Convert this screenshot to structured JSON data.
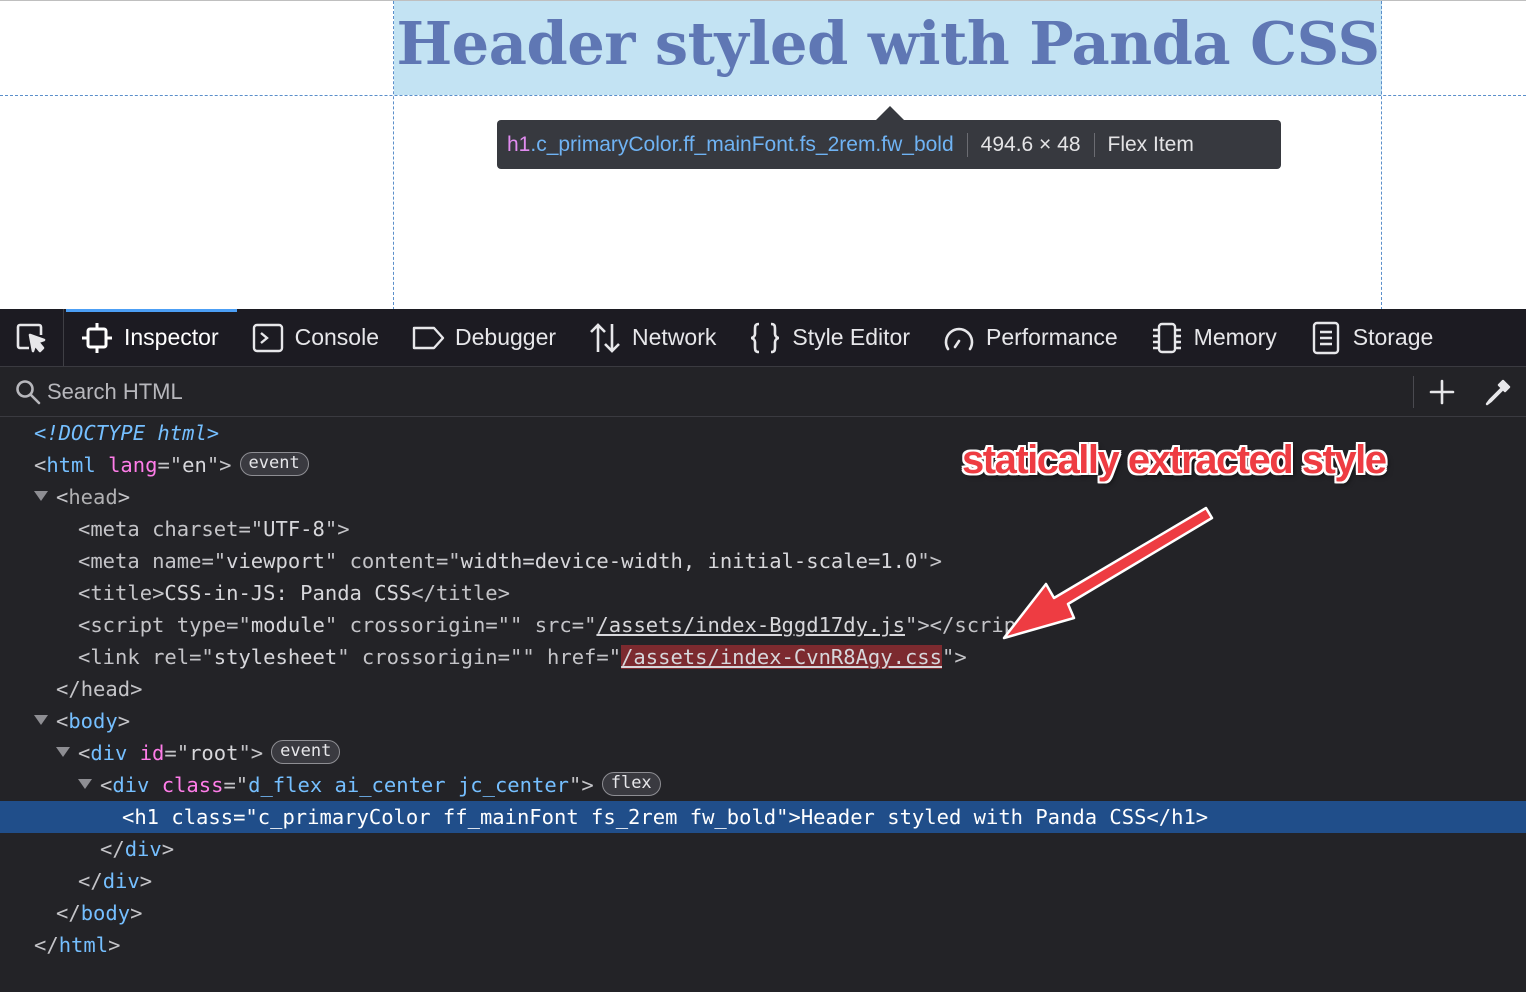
{
  "preview": {
    "heading": "Header styled with Panda CSS",
    "tooltip": {
      "tag": "h1",
      "classes": ".c_primaryColor.ff_mainFont.fs_2rem.fw_bold",
      "dimensions": "494.6 × 48",
      "role": "Flex Item"
    }
  },
  "toolbar": {
    "tabs": [
      {
        "label": "Inspector",
        "icon": "inspector-icon",
        "active": true
      },
      {
        "label": "Console",
        "icon": "console-icon"
      },
      {
        "label": "Debugger",
        "icon": "debugger-icon"
      },
      {
        "label": "Network",
        "icon": "network-icon"
      },
      {
        "label": "Style Editor",
        "icon": "style-editor-icon"
      },
      {
        "label": "Performance",
        "icon": "performance-icon"
      },
      {
        "label": "Memory",
        "icon": "memory-icon"
      },
      {
        "label": "Storage",
        "icon": "storage-icon"
      }
    ]
  },
  "search": {
    "placeholder": "Search HTML"
  },
  "tree": {
    "doctype": "<!DOCTYPE html>",
    "html_tag": "html",
    "lang_attr": "lang",
    "lang_val": "en",
    "event_badge": "event",
    "head_tag": "head",
    "meta_charset_attr": "charset",
    "meta_charset_val": "UTF-8",
    "meta_name_attr": "name",
    "meta_name_val": "viewport",
    "meta_content_attr": "content",
    "meta_content_val": "width=device-width, initial-scale=1.0",
    "title_tag": "title",
    "title_text": "CSS-in-JS: Panda CSS",
    "script_tag": "script",
    "type_attr": "type",
    "type_val": "module",
    "crossorigin_attr": "crossorigin",
    "crossorigin_val": "",
    "src_attr": "src",
    "src_val": "/assets/index-Bggd17dy.js",
    "link_tag": "link",
    "rel_attr": "rel",
    "rel_val": "stylesheet",
    "href_attr": "href",
    "href_val": "/assets/index-CvnR8Agy.css",
    "body_tag": "body",
    "div_tag": "div",
    "id_attr": "id",
    "id_val": "root",
    "class_attr": "class",
    "div_class_val": "d_flex ai_center jc_center",
    "flex_badge": "flex",
    "h1_tag": "h1",
    "h1_class_val": "c_primaryColor ff_mainFont fs_2rem fw_bold",
    "h1_text": "Header styled with Panda CSS"
  },
  "annotation": {
    "text": "statically extracted style",
    "color": "#ee3c42"
  },
  "colors": {
    "tag": "#75bfff",
    "attr": "#ff7de9",
    "selected_row": "#204e8a",
    "active_tab": "#4c9ff5",
    "heading": "#5f77b4",
    "highlight": "#c3e3f3"
  }
}
